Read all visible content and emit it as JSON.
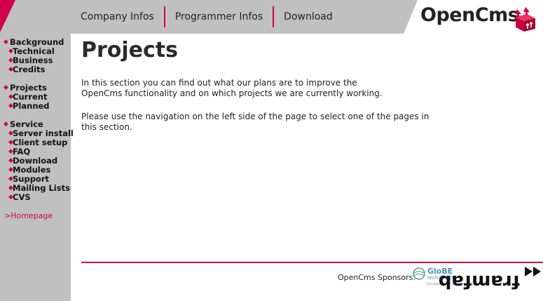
{
  "topnav": {
    "items": [
      "Company Infos",
      "Programmer Infos",
      "Download"
    ]
  },
  "logo": {
    "text": "OpenCms"
  },
  "sidebar": {
    "groups": [
      {
        "label": "Background",
        "items": [
          "Technical",
          "Business",
          "Credits"
        ]
      },
      {
        "label": "Projects",
        "items": [
          "Current",
          "Planned"
        ]
      },
      {
        "label": "Service",
        "items": [
          "Server install",
          "Client setup",
          "FAQ",
          "Download",
          "Modules",
          "Support",
          "Mailing Lists",
          "CVS"
        ]
      }
    ],
    "homepage": ">Homepage"
  },
  "main": {
    "title": "Projects",
    "paragraph1": "In this section you can find out what our plans are to improve the OpenCms functionality and on which projects we are currently working.",
    "paragraph2": "Please use the navigation on the left side of the page to select one of the pages in this section."
  },
  "footer": {
    "sponsors_label": "OpenCms Sponsors:",
    "sponsor1_name": "GloBE",
    "sponsor1_sub": "technology",
    "sponsor1_tiny": "Ein Unternehmen der conSolid Gruppe",
    "sponsor2_name": "framfab"
  },
  "colors": {
    "accent": "#d0004b",
    "band": "#c0c0c0",
    "globe_blue": "#4a8fc0"
  }
}
